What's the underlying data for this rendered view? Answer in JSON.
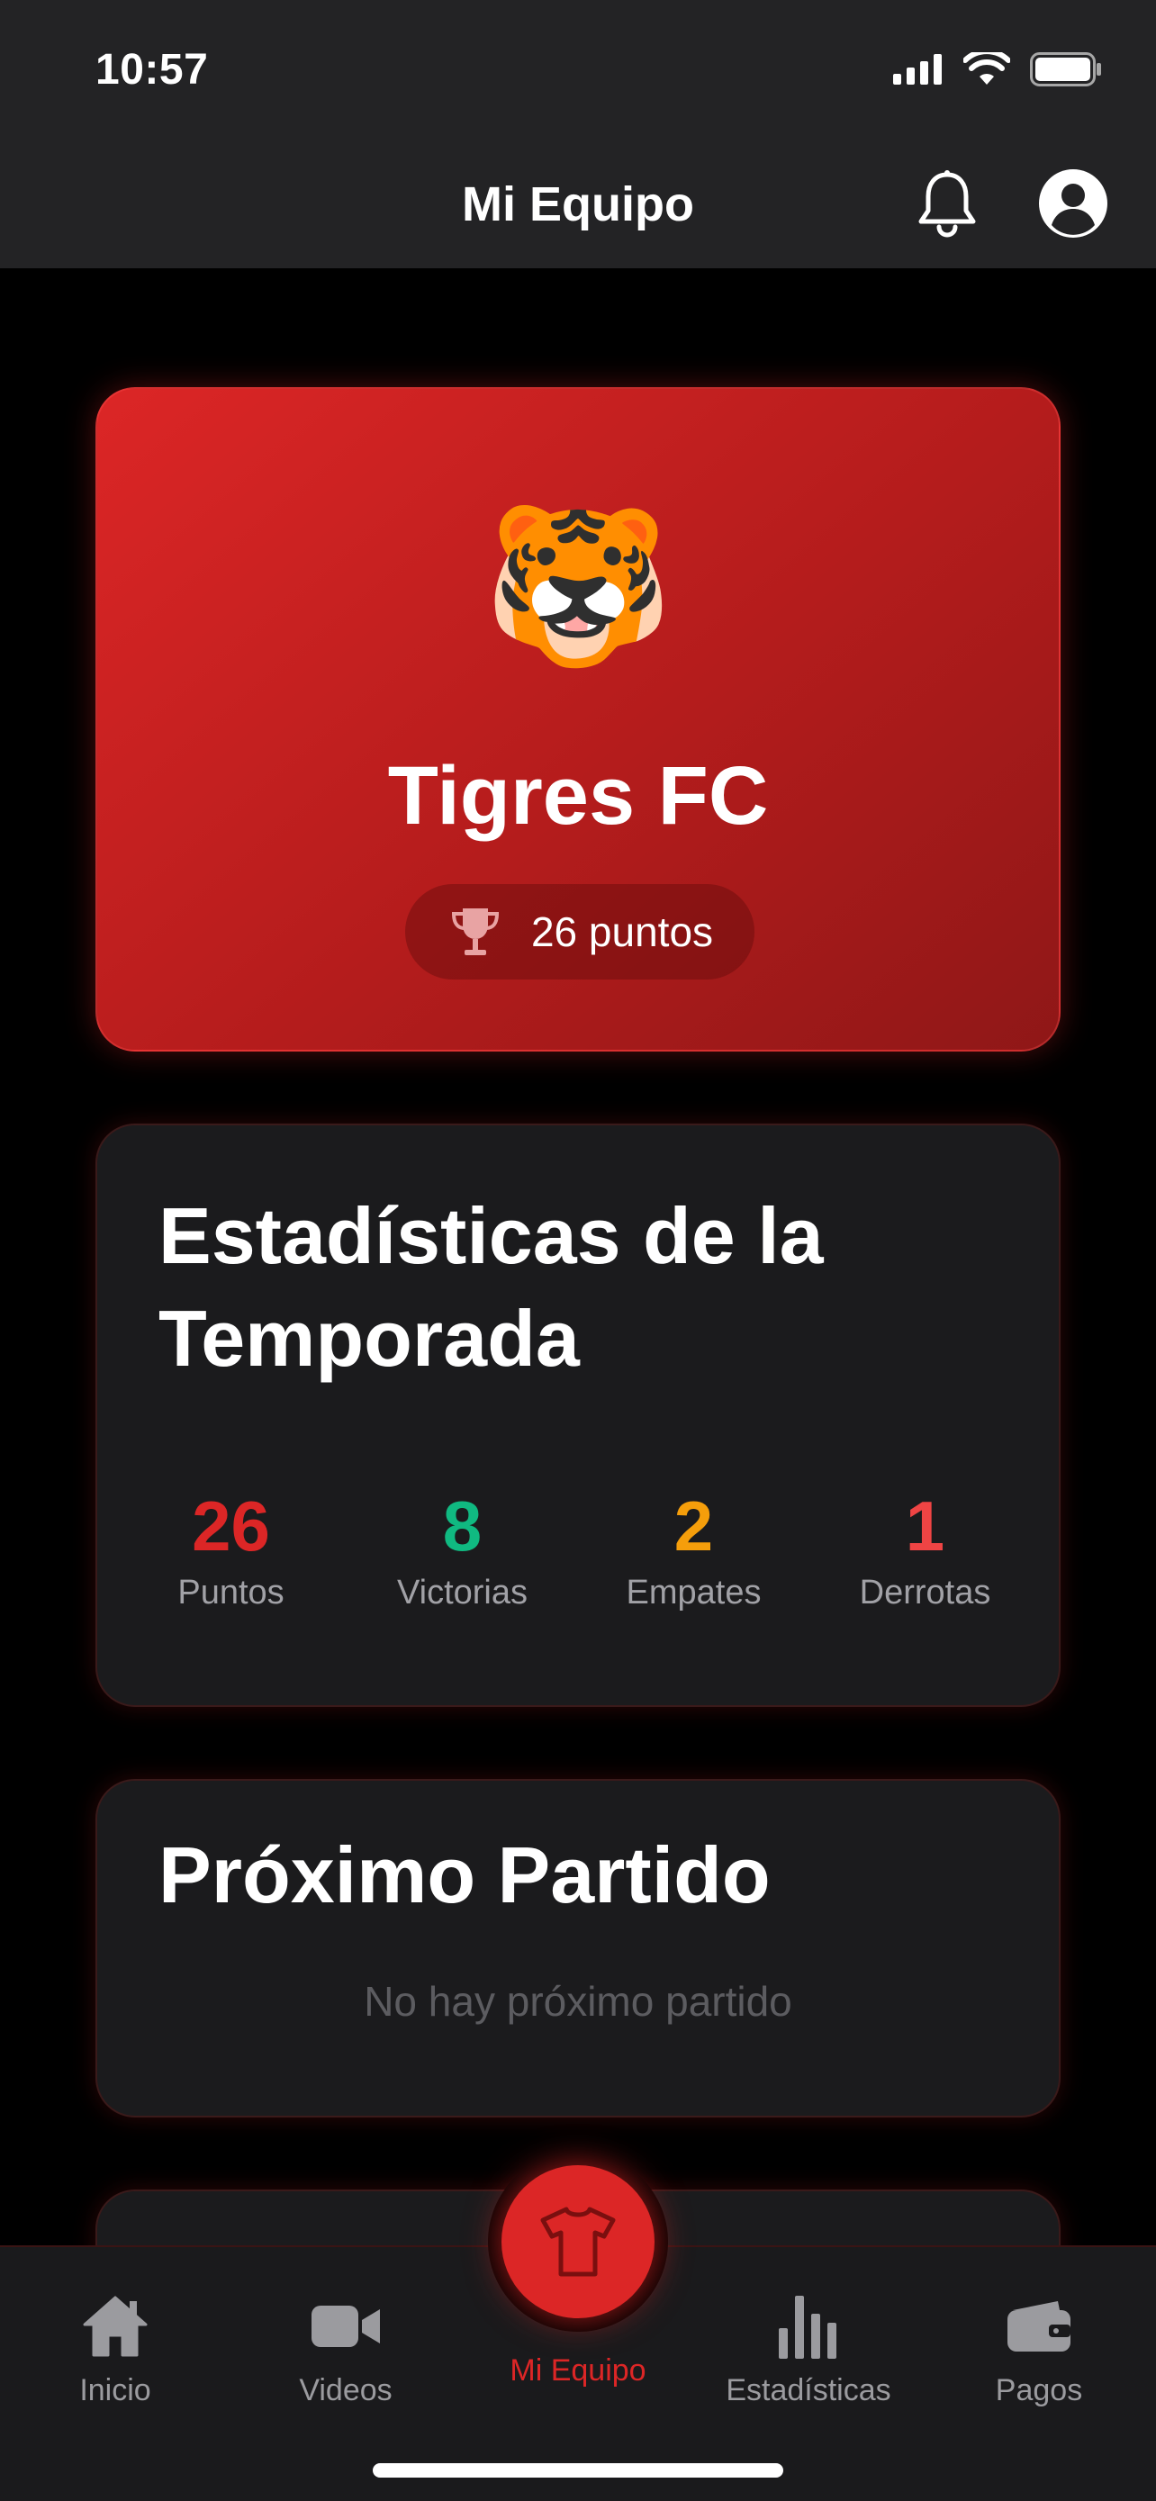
{
  "status_bar": {
    "time": "10:57"
  },
  "header": {
    "title": "Mi Equipo"
  },
  "team": {
    "emoji": "🐯",
    "name": "Tigres FC",
    "points_text": "26 puntos"
  },
  "season_stats": {
    "title": "Estadísticas de la Temporada",
    "items": [
      {
        "value": "26",
        "label": "Puntos",
        "color": "#dc2626"
      },
      {
        "value": "8",
        "label": "Victorias",
        "color": "#10b981"
      },
      {
        "value": "2",
        "label": "Empates",
        "color": "#f59e0b"
      },
      {
        "value": "1",
        "label": "Derrotas",
        "color": "#ef4444"
      }
    ]
  },
  "next_match": {
    "title": "Próximo Partido",
    "empty_text": "No hay próximo partido"
  },
  "bottom_nav": {
    "items": [
      {
        "label": "Inicio",
        "icon": "home-icon"
      },
      {
        "label": "Videos",
        "icon": "video-camera-icon"
      },
      {
        "label": "Mi Equipo",
        "icon": "shirt-icon",
        "active": true
      },
      {
        "label": "Estadísticas",
        "icon": "bar-chart-icon"
      },
      {
        "label": "Pagos",
        "icon": "wallet-icon"
      }
    ]
  },
  "colors": {
    "accent": "#dc2626",
    "background": "#000000",
    "card": "#1b1b1d"
  }
}
